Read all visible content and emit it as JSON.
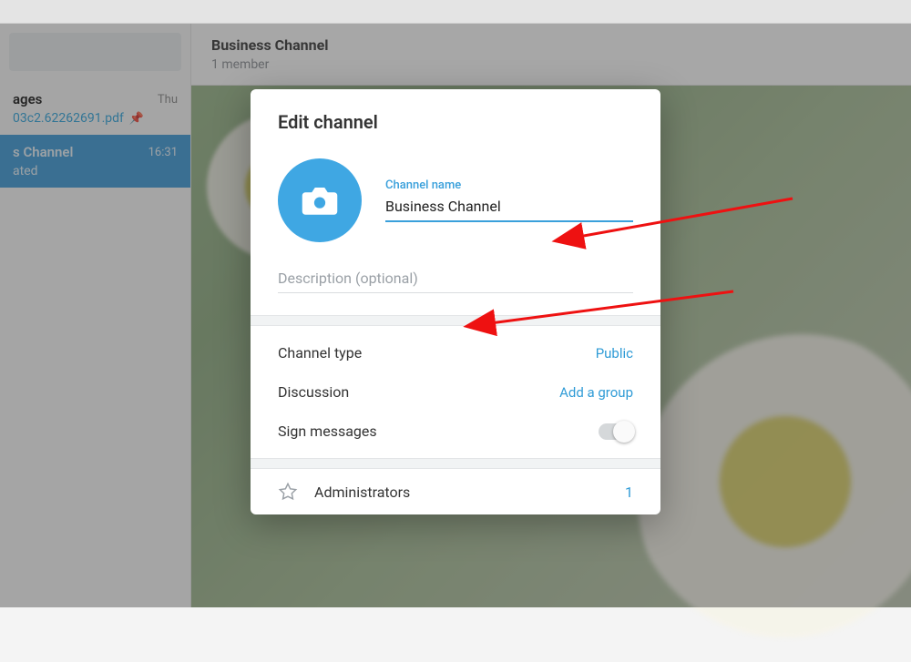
{
  "header": {
    "title": "Business Channel",
    "members": "1 member"
  },
  "sidebar": {
    "saved": {
      "title": "ages",
      "time": "Thu",
      "file": "03c2.62262691.pdf"
    },
    "channel": {
      "title": "s Channel",
      "time": "16:31",
      "sub": "ated"
    }
  },
  "dialog": {
    "title": "Edit channel",
    "nameLabel": "Channel name",
    "nameValue": "Business Channel",
    "descPlaceholder": "Description (optional)",
    "rows": {
      "channelType": {
        "label": "Channel type",
        "value": "Public"
      },
      "discussion": {
        "label": "Discussion",
        "value": "Add a group"
      },
      "sign": {
        "label": "Sign messages"
      }
    },
    "admins": {
      "label": "Administrators",
      "count": "1"
    }
  }
}
